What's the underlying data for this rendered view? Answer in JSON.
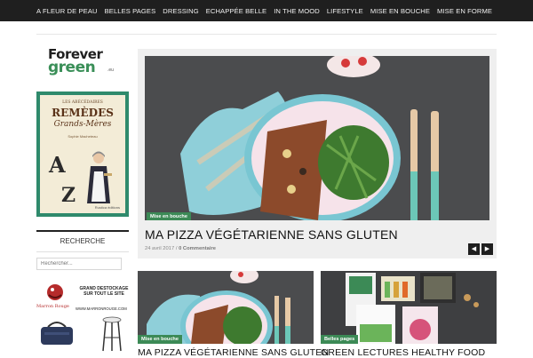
{
  "nav": {
    "items": [
      "A FLEUR DE PEAU",
      "BELLES PAGES",
      "DRESSING",
      "ECHAPPÉE BELLE",
      "IN THE MOOD",
      "LIFESTYLE",
      "MISE EN BOUCHE",
      "MISE EN FORME"
    ]
  },
  "logo": {
    "line1": "Forever",
    "line2": "green",
    "suffix": ".eu"
  },
  "book": {
    "line1": "LES ABÉCÉDAIRES",
    "line2": "REMÈDES",
    "line3": "Grands-Mères",
    "line4": "Sophie Macheteau",
    "letter_a": "A",
    "letter_z": "Z",
    "publisher": "Rustica éditions"
  },
  "sidebar": {
    "search_title": "RECHERCHE",
    "search_placeholder": "Rechercher..."
  },
  "ad": {
    "brand": "Marron Rouge",
    "headline": "GRAND DESTOCKAGE SUR TOUT LE SITE",
    "url": "WWW.MARRONROUGE.COM"
  },
  "featured": {
    "category": "Mise en bouche",
    "title": "MA PIZZA VÉGÉTARIENNE SANS GLUTEN",
    "date": "24 avril 2017",
    "separator": "/",
    "comments": "0 Commentaire",
    "prev_icon": "chevron-left-icon",
    "next_icon": "chevron-right-icon"
  },
  "cards": [
    {
      "category": "Mise en bouche",
      "title": "MA PIZZA VÉGÉTARIENNE SANS GLUTEN"
    },
    {
      "category": "Belles pages",
      "title": "GREEN LECTURES HEALTHY FOOD"
    }
  ],
  "colors": {
    "nav_bg": "#1f1f1f",
    "accent_green": "#3c8a56"
  }
}
